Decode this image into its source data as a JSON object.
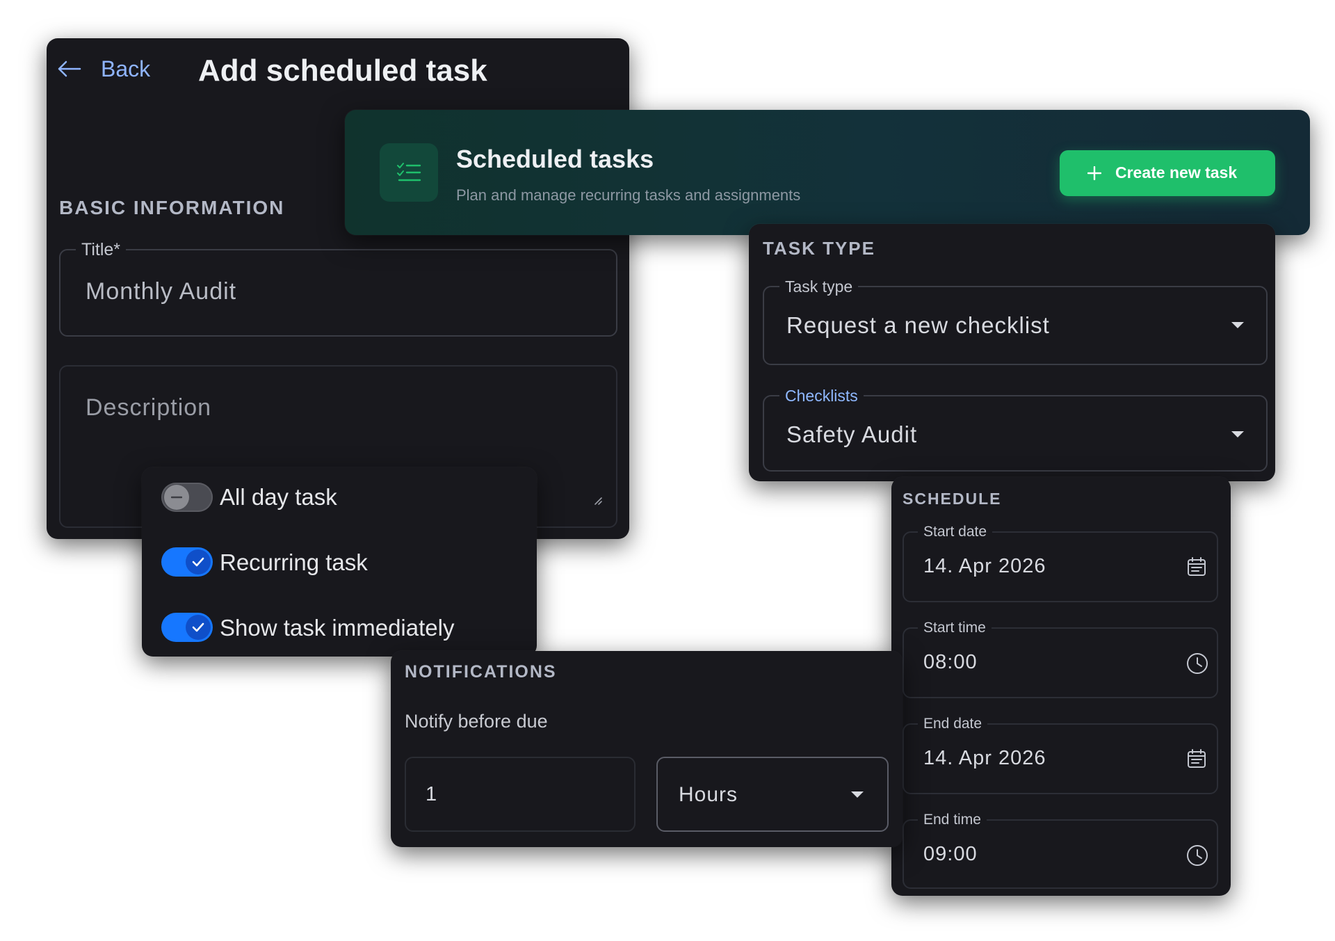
{
  "header": {
    "back_label": "Back",
    "title": "Add scheduled task"
  },
  "basic_info": {
    "section_title": "BASIC INFORMATION",
    "title_field": {
      "label": "Title*",
      "value": "Monthly Audit"
    },
    "description_field": {
      "placeholder": "Description"
    }
  },
  "banner": {
    "title": "Scheduled tasks",
    "subtitle": "Plan and manage recurring tasks and assignments",
    "create_button_label": "Create new task",
    "icon": "checklist-icon"
  },
  "task_type": {
    "section_title": "TASK TYPE",
    "type_field": {
      "label": "Task type",
      "value": "Request a new checklist"
    },
    "checklists_field": {
      "label": "Checklists",
      "value": "Safety Audit"
    }
  },
  "toggles": [
    {
      "label": "All day task",
      "on": false
    },
    {
      "label": "Recurring task",
      "on": true
    },
    {
      "label": "Show task immediately",
      "on": true
    }
  ],
  "schedule": {
    "section_title": "SCHEDULE",
    "start_date": {
      "label": "Start date",
      "value": "14. Apr 2026"
    },
    "start_time": {
      "label": "Start time",
      "value": "08:00"
    },
    "end_date": {
      "label": "End date",
      "value": "14. Apr 2026"
    },
    "end_time": {
      "label": "End time",
      "value": "09:00"
    }
  },
  "notifications": {
    "section_title": "NOTIFICATIONS",
    "notify_label": "Notify before due",
    "amount": "1",
    "unit": "Hours"
  },
  "colors": {
    "accent_green": "#1fbf6b",
    "toggle_on": "#1677ff",
    "checklist_label": "#8fb8ff",
    "back_link": "#8fb4ff"
  }
}
